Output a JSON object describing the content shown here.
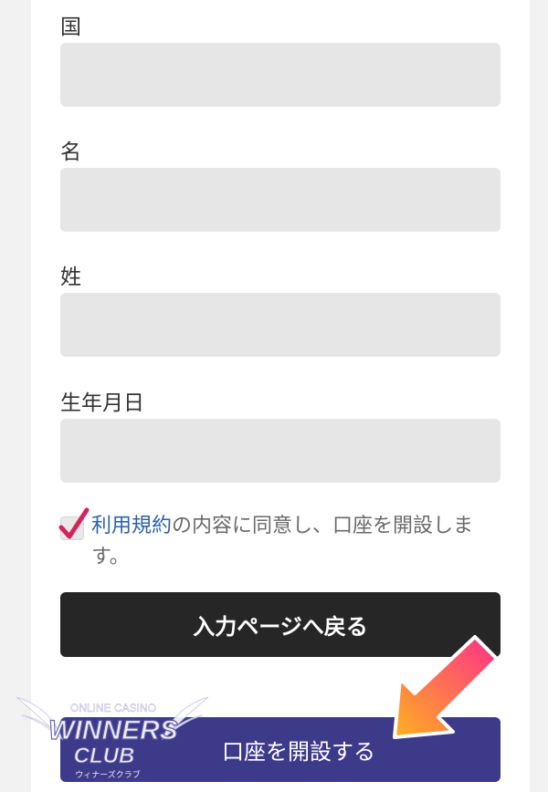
{
  "form": {
    "fields": [
      {
        "label": "国",
        "value": ""
      },
      {
        "label": "名",
        "value": ""
      },
      {
        "label": "姓",
        "value": ""
      },
      {
        "label": "生年月日",
        "value": ""
      }
    ],
    "consent": {
      "checked": true,
      "link_text": "利用規約",
      "text_rest": "の内容に同意し、口座を開設します。"
    },
    "back_button_label": "入力ページへ戻る",
    "open_account_button_label": "口座を開設する"
  },
  "logo": {
    "line1": "ONLINE CASINO",
    "line2": "WINNERS",
    "line3": "CLUB",
    "line4": "ウィナーズクラブ"
  },
  "colors": {
    "field_bg": "#e6e6e6",
    "back_button_bg": "#262626",
    "open_button_bg": "#3e3a8a",
    "link": "#2f62a8",
    "check": "#d6245a",
    "arrow_start": "#ffb020",
    "arrow_end": "#ff2f8a"
  },
  "icons": {
    "checkmark": "checkmark-icon",
    "arrow": "arrow-pointer-icon"
  }
}
